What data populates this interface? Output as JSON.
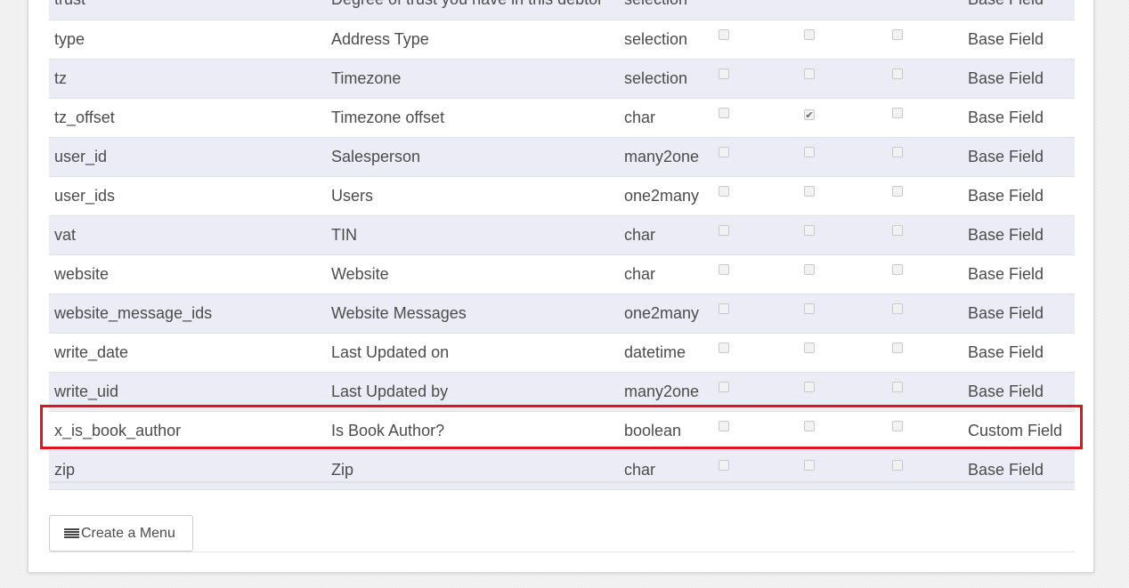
{
  "fields_table": {
    "rows": [
      {
        "name": "trust",
        "label": "Degree of trust you have in this debtor",
        "type": "selection",
        "required": false,
        "readonly": false,
        "indexed": false,
        "origin": "Base Field"
      },
      {
        "name": "type",
        "label": "Address Type",
        "type": "selection",
        "required": false,
        "readonly": false,
        "indexed": false,
        "origin": "Base Field"
      },
      {
        "name": "tz",
        "label": "Timezone",
        "type": "selection",
        "required": false,
        "readonly": false,
        "indexed": false,
        "origin": "Base Field"
      },
      {
        "name": "tz_offset",
        "label": "Timezone offset",
        "type": "char",
        "required": false,
        "readonly": true,
        "indexed": false,
        "origin": "Base Field"
      },
      {
        "name": "user_id",
        "label": "Salesperson",
        "type": "many2one",
        "required": false,
        "readonly": false,
        "indexed": false,
        "origin": "Base Field"
      },
      {
        "name": "user_ids",
        "label": "Users",
        "type": "one2many",
        "required": false,
        "readonly": false,
        "indexed": false,
        "origin": "Base Field"
      },
      {
        "name": "vat",
        "label": "TIN",
        "type": "char",
        "required": false,
        "readonly": false,
        "indexed": false,
        "origin": "Base Field"
      },
      {
        "name": "website",
        "label": "Website",
        "type": "char",
        "required": false,
        "readonly": false,
        "indexed": false,
        "origin": "Base Field"
      },
      {
        "name": "website_message_ids",
        "label": "Website Messages",
        "type": "one2many",
        "required": false,
        "readonly": false,
        "indexed": false,
        "origin": "Base Field"
      },
      {
        "name": "write_date",
        "label": "Last Updated on",
        "type": "datetime",
        "required": false,
        "readonly": false,
        "indexed": false,
        "origin": "Base Field"
      },
      {
        "name": "write_uid",
        "label": "Last Updated by",
        "type": "many2one",
        "required": false,
        "readonly": false,
        "indexed": false,
        "origin": "Base Field"
      },
      {
        "name": "x_is_book_author",
        "label": "Is Book Author?",
        "type": "boolean",
        "required": false,
        "readonly": false,
        "indexed": false,
        "origin": "Custom Field",
        "highlighted": true
      },
      {
        "name": "zip",
        "label": "Zip",
        "type": "char",
        "required": false,
        "readonly": false,
        "indexed": false,
        "origin": "Base Field"
      }
    ]
  },
  "footer": {
    "create_menu_label": "Create a Menu",
    "create_menu_icon": "list-icon"
  },
  "colors": {
    "highlight": "#e0141b",
    "row_stripe": "#ececf6"
  }
}
